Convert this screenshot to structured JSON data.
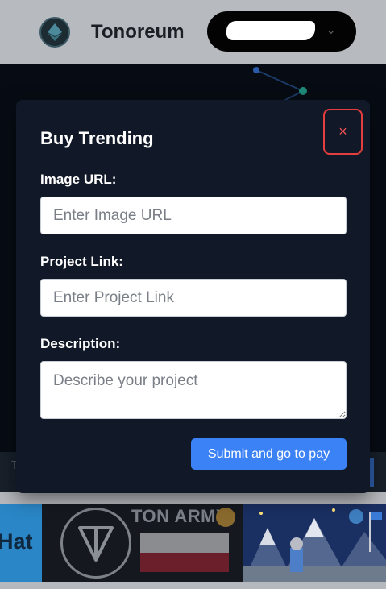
{
  "header": {
    "brand": "Tonoreum",
    "logo_icon": "ethereum-diamond-icon",
    "wallet_chevron_icon": "chevron-down-icon"
  },
  "modal": {
    "title": "Buy Trending",
    "close_label": "×",
    "fields": {
      "image_url": {
        "label": "Image URL:",
        "placeholder": "Enter Image URL",
        "value": ""
      },
      "project_link": {
        "label": "Project Link:",
        "placeholder": "Enter Project Link",
        "value": ""
      },
      "description": {
        "label": "Description:",
        "placeholder": "Describe your project",
        "value": ""
      }
    },
    "submit_label": "Submit and go to pay"
  },
  "strip": {
    "partial_text": "T"
  },
  "thumbnails": [
    {
      "name": "hat-token",
      "text": "Hat"
    },
    {
      "name": "ton-army-token",
      "text": "TON ARMY"
    },
    {
      "name": "pixel-art-token",
      "text": ""
    }
  ],
  "colors": {
    "accent": "#3b82f6",
    "close_border": "#e53e3e",
    "modal_bg": "#111827"
  }
}
